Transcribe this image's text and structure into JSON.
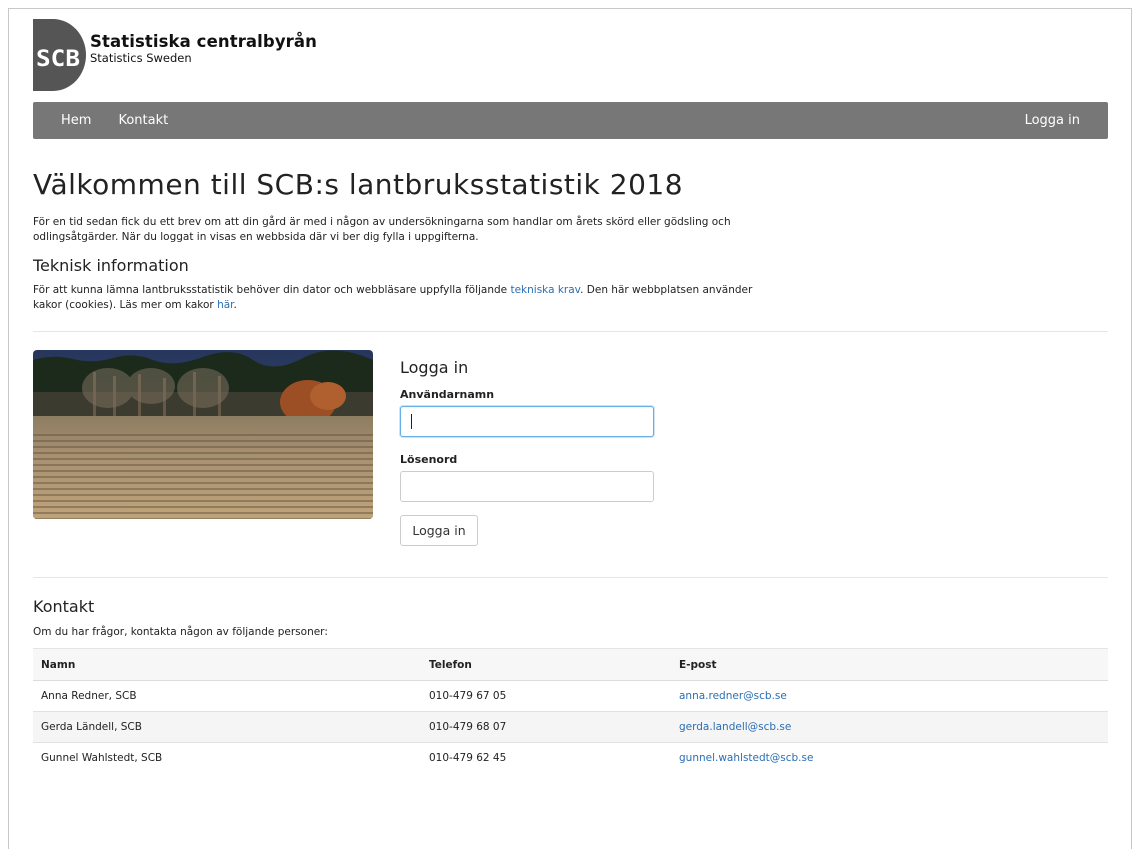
{
  "brand": {
    "logo_mark": "SCB",
    "name": "Statistiska centralbyrån",
    "subtitle": "Statistics Sweden"
  },
  "nav": {
    "home": "Hem",
    "contact": "Kontakt",
    "login": "Logga in"
  },
  "page": {
    "title": "Välkommen till SCB:s lantbruksstatistik 2018",
    "intro": "För en tid sedan fick du ett brev om att din gård är med i någon av undersökningarna som handlar om årets skörd eller gödsling och odlingsåtgärder. När du loggat in visas en webbsida där vi ber dig fylla i uppgifterna."
  },
  "tech": {
    "heading": "Teknisk information",
    "text_before": "För att kunna lämna lantbruksstatistik behöver din dator och webbläsare uppfylla följande ",
    "link_requirements": "tekniska krav",
    "text_middle": ". Den här webbplatsen använder kakor (cookies). Läs mer om kakor ",
    "link_cookies": "här",
    "text_after": "."
  },
  "login": {
    "heading": "Logga in",
    "username_label": "Användarnamn",
    "username_value": "",
    "password_label": "Lösenord",
    "password_value": "",
    "button": "Logga in"
  },
  "contact": {
    "heading": "Kontakt",
    "intro": "Om du har frågor, kontakta någon av följande personer:",
    "columns": [
      "Namn",
      "Telefon",
      "E-post"
    ],
    "rows": [
      {
        "name": "Anna Redner, SCB",
        "phone": "010-479 67 05",
        "email": "anna.redner@scb.se"
      },
      {
        "name": "Gerda Ländell, SCB",
        "phone": "010-479 68 07",
        "email": "gerda.landell@scb.se"
      },
      {
        "name": "Gunnel Wahlstedt, SCB",
        "phone": "010-479 62 45",
        "email": "gunnel.wahlstedt@scb.se"
      }
    ]
  },
  "colors": {
    "navbar": "#777777",
    "link": "#2a6eb3",
    "logo_dark": "#555555"
  }
}
